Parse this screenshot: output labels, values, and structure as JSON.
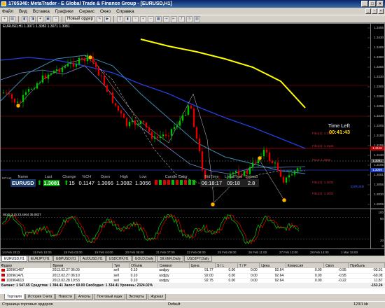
{
  "window": {
    "title": "1705340: MetaTrader - E Global Trade & Finance Group - [EURUSD,H1]"
  },
  "menu": [
    "Файл",
    "Вид",
    "Вставка",
    "Графики",
    "Сервис",
    "Окно",
    "Справка"
  ],
  "toolbar": {
    "new_order": "Новый ордер"
  },
  "chart": {
    "header": "EURUSD,H1 1.3071 1.3082 1.3071 1.3081",
    "price_labels": [
      "1.3455",
      "1.3430",
      "1.3405",
      "1.3380",
      "1.3355",
      "1.3330",
      "1.3305",
      "1.3280",
      "1.3255",
      "1.3230",
      "1.3205",
      "1.3180",
      "1.3155",
      "1.3130",
      "1.3105",
      "1.3081",
      "1.3055",
      "1.3030",
      "1.3005"
    ],
    "current_price": "1.3081",
    "red_level": "1.3116",
    "blue_level": "1.3069",
    "time_left_label": "Time Left",
    "time_left": "00:41:43",
    "level_labels": [
      "Fibo(1): 1.3141",
      "Fibo(2): 1.3126",
      "Pivot: 1.3060",
      "Fibo(3): 1.3032",
      "Fibo(4): 1.3002"
    ],
    "sym_tag": "EURUSD",
    "stoch_label": "Sto(5,3,3) 23.4464 35.0827",
    "stoch_scale": [
      "100",
      "80",
      "20",
      "0"
    ],
    "time_labels": [
      "14 Feb 2013",
      "15 Feb 10:00",
      "18 Feb 03:00",
      "19 Feb 04:00",
      "20 Feb 05:00",
      "21 Feb 07:00",
      "22 Feb 08:00",
      "25 Feb 09:00",
      "26 Feb 11:00",
      "27 Feb 13:00",
      "28 Feb 14:00",
      "1 Mar 15:00"
    ]
  },
  "data_panel": {
    "brand": "MT.net",
    "headers": [
      "Name",
      "Last",
      "Change",
      "%CH",
      "Open",
      "High",
      "Low",
      "Candle Color",
      "BidTime",
      "LocalTime",
      "Spread"
    ],
    "values": [
      "EURUSD",
      "1.3081",
      "15",
      "0.1147",
      "1.3066",
      "1.3082",
      "1.3056",
      "",
      "06:18:17",
      "09:18",
      "2.8"
    ]
  },
  "chart_tabs": [
    "EURUSD,H1",
    "EURJPY,H1",
    "GBPUSD,H1",
    "AUDUSD,H1",
    "USDCHF,H1",
    "GOLD,Daily",
    "SILVER,Daily",
    "USDJPY,Daily"
  ],
  "terminal": {
    "columns": [
      "Ордер",
      "Время",
      "Тип",
      "Объём",
      "Символ",
      "Цена",
      "S / L",
      "T / P",
      "Цена",
      "Комиссия",
      "Своп",
      "Прибыль"
    ],
    "rows": [
      [
        "100961467",
        "2013.02.27 06:09",
        "sell",
        "0.10",
        "usdjpy",
        "91.77",
        "0.00",
        "0.00",
        "92.64",
        "0.00",
        "-0.95",
        "-93.91"
      ],
      [
        "100961471",
        "2013.02.27 06:10",
        "sell",
        "0.10",
        "usdjpy",
        "92.00",
        "0.00",
        "0.00",
        "92.64",
        "0.00",
        "-0.95",
        "-69.08"
      ],
      [
        "100964613",
        "2013.02.28 19:53",
        "sell",
        "0.10",
        "usdjpy",
        "92.75",
        "0.00",
        "0.00",
        "92.64",
        "0.00",
        "-0.22",
        "11.87"
      ]
    ],
    "balance": "Баланс: 1 547.65 Средства: 1 394.41 Залог: 60.00 Свободно: 1 334.41 Уровень: 2324.02%",
    "balance_profit": "-153.24",
    "tabs": [
      "Торговля",
      "История Счета",
      "Новости",
      "Алерты",
      "Почтовый ящик",
      "Эксперты",
      "Журнал"
    ]
  },
  "status": {
    "left": "Страница торговых ордеров",
    "mid": "Default",
    "right": "123/1 kb"
  },
  "colors": {
    "bull": "#00c000",
    "bear": "#e00000",
    "ma_yellow": "#ffff00",
    "ma_blue": "#3060ff"
  }
}
